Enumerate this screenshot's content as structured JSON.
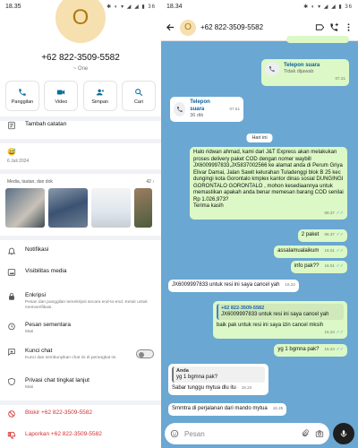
{
  "left": {
    "status_time": "18.35",
    "status_icons": "✱ ◐ ▾ ◢ ◢ ▮ 36",
    "avatar_letter": "O",
    "phone": "+62 822-3509-5582",
    "subtitle": "~ One",
    "actions": [
      {
        "label": "Panggilan",
        "icon": "phone-icon"
      },
      {
        "label": "Video",
        "icon": "video-icon"
      },
      {
        "label": "Simpan",
        "icon": "add-person-icon"
      },
      {
        "label": "Cari",
        "icon": "search-icon"
      }
    ],
    "add_note": "Tambah catatan",
    "about_emoji": "😅",
    "about_date": "6 Juli 2024",
    "media_label": "Media, tautan, dan dok",
    "media_count": "42 ›",
    "notifications": "Notifikasi",
    "media_visibility": "Visibilitas media",
    "encryption": {
      "title": "Enkripsi",
      "desc": "Pesan dan panggilan terenkripsi secara end-to-end. Ketuk untuk memverifikasi."
    },
    "disappearing": {
      "title": "Pesan sementara",
      "sub": "Mati"
    },
    "chat_lock": {
      "title": "Kunci chat",
      "desc": "Kunci dan sembunyikan chat ini di perangkat ini."
    },
    "privacy": {
      "title": "Privasi chat tingkat lanjut",
      "sub": "Mati"
    },
    "block": "Blokir +62 822-3509-5582",
    "report": "Laporkan +62 822-3509-5582"
  },
  "right": {
    "status_time": "18.34",
    "status_icons": "✱ ◐ ▾ ◢ ◢ ▮ 36",
    "header": {
      "avatar_letter": "O",
      "phone": "+62 822-3509-5582"
    },
    "messages": {
      "call_out": {
        "title": "Telepon suara",
        "status": "Tidak dijawab",
        "time": "07.31"
      },
      "call_in": {
        "title": "Telepon suara",
        "status": "36 dtk",
        "time": "07.51"
      },
      "date": "Hari ini",
      "long": {
        "text": "Halo ridwan ahmad, kami dari J&T Express akan melakukan proses delivery paket COD dengan nomer waybill JX6009997833,JX5837002566 ke alamat anda di Perum Griya Elivar Damai, Jalan Sawit kelurahan Tuladenggi blok B 25 kec dungingi kota Gorontalo kmplex kantor dinas sosial DUNGINGI GORONTALO GORONTALO , mohon kesediaannya untuk memastikan apakah anda benar memesan barang COD senilai Rp 1.026,973?\nTerima kasih",
        "time": "08.37"
      },
      "m1": {
        "text": "2 paket",
        "time": "08.37"
      },
      "m2": {
        "text": "assalamualaikum",
        "time": "16.01"
      },
      "m3": {
        "text": "info pak??",
        "time": "16.01"
      },
      "m4": {
        "text": "JX6009997833 untuk resi ini saya cancel yah",
        "time": "16.22"
      },
      "m5": {
        "quote_name": "+62 822-3509-5582",
        "quote_text": "JX6009997833 untuk resi ini saya cancel yah",
        "text": "baik pak untuk resi ini saya izin cancel mksih",
        "time": "16.24"
      },
      "m6": {
        "text": "yg 1 bgmna pak?",
        "time": "16.24"
      },
      "m7": {
        "quote_name": "Anda",
        "quote_text": "yg 1 bgmna pak?",
        "text": "Sabar tunggu mytua dlu itu",
        "time": "16.24"
      },
      "m8": {
        "text": "Smmtra di perjalanan dari mando mytua",
        "time": "16.25"
      }
    },
    "input_placeholder": "Pesan"
  }
}
